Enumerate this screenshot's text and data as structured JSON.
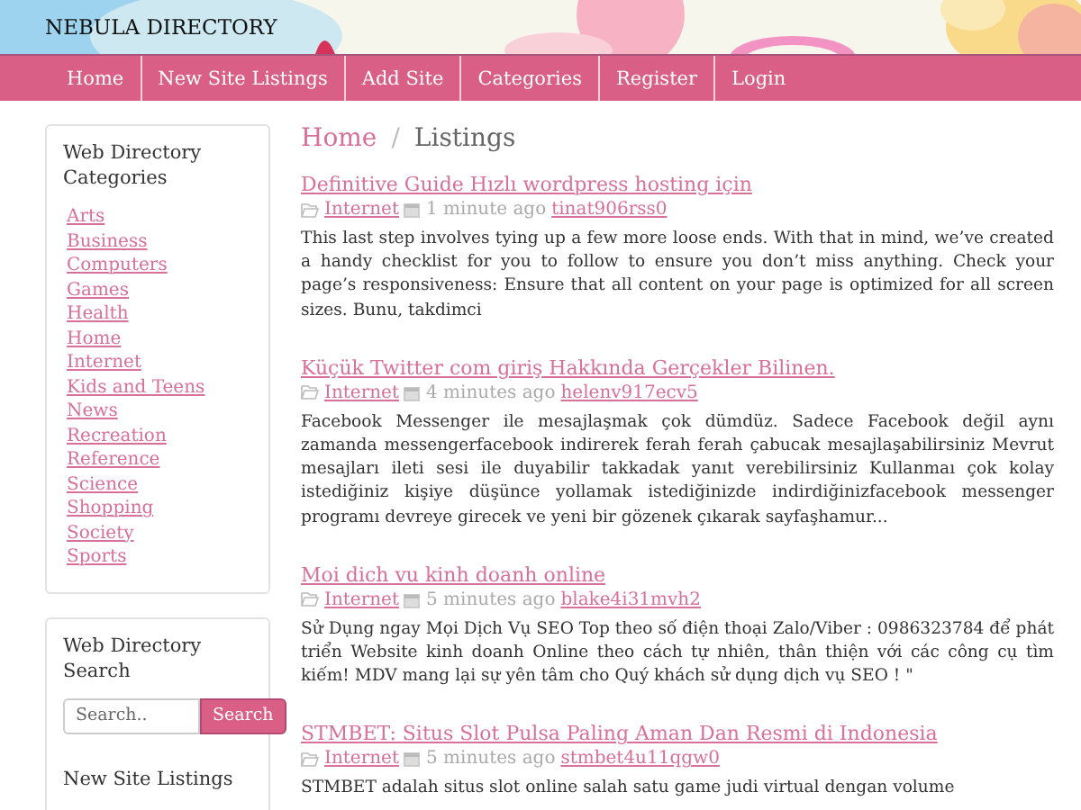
{
  "header": {
    "title": "NEBULA DIRECTORY"
  },
  "nav": [
    {
      "label": "Home"
    },
    {
      "label": "New Site Listings"
    },
    {
      "label": "Add Site"
    },
    {
      "label": "Categories"
    },
    {
      "label": "Register"
    },
    {
      "label": "Login"
    }
  ],
  "sidebar": {
    "categories": {
      "title": "Web Directory Categories",
      "items": [
        "Arts",
        "Business",
        "Computers",
        "Games",
        "Health",
        "Home",
        "Internet",
        "Kids and Teens",
        "News",
        "Recreation",
        "Reference",
        "Science",
        "Shopping",
        "Society",
        "Sports"
      ]
    },
    "search": {
      "title": "Web Directory Search",
      "placeholder": "Search..",
      "button": "Search"
    },
    "new_listings": {
      "title": "New Site Listings"
    }
  },
  "breadcrumb": [
    {
      "label": "Home",
      "kind": "link"
    },
    {
      "label": "/",
      "kind": "separator"
    },
    {
      "label": "Listings",
      "kind": "current"
    }
  ],
  "listings": [
    {
      "title": "Definitive Guide Hızlı wordpress hosting için",
      "category": "Internet",
      "time": "1 minute ago",
      "user": "tinat906rss0",
      "text": "This last step involves tying up a few more loose ends. With that in mind, we’ve created a handy checklist for you to follow to ensure you don’t miss anything. Check your page’s responsiveness: Ensure that all content on your page is optimized for all screen sizes. Bunu, takdimci"
    },
    {
      "title": "Küçük Twitter com giriş Hakkında Gerçekler Bilinen.",
      "category": "Internet",
      "time": "4 minutes ago",
      "user": "helenv917ecv5",
      "text": "Facebook Messenger ile mesajlaşmak çok dümdüz. Sadece Facebook değil aynı zamanda messengerfacebook indirerek ferah ferah çabucak mesajlaşabilirsiniz Mevrut mesajları ileti sesi ile duyabilir takkadak yanıt verebilirsiniz Kullanmaı çok kolay istediğiniz kişiye düşünce yollamak istediğinizde indirdiğinizfacebook messenger programı devreye girecek ve yeni bir gözenek çıkarak sayfaşhamur..."
    },
    {
      "title": "Moi dich vu kinh doanh online",
      "category": "Internet",
      "time": "5 minutes ago",
      "user": "blake4i31mvh2",
      "text": "Sử Dụng ngay Mọi Dịch Vụ SEO Top theo số điện thoại Zalo/Viber : 0986323784 để phát triển Website kinh doanh Online theo cách tự nhiên, thân thiện với các công cụ tìm kiếm! MDV mang lại sự yên tâm cho Quý khách sử dụng dịch vụ SEO ! \""
    },
    {
      "title": "STMBET: Situs Slot Pulsa Paling Aman Dan Resmi di Indonesia",
      "category": "Internet",
      "time": "5 minutes ago",
      "user": "stmbet4u11qgw0",
      "text": "STMBET adalah situs slot online salah satu game judi virtual dengan volume"
    }
  ]
}
